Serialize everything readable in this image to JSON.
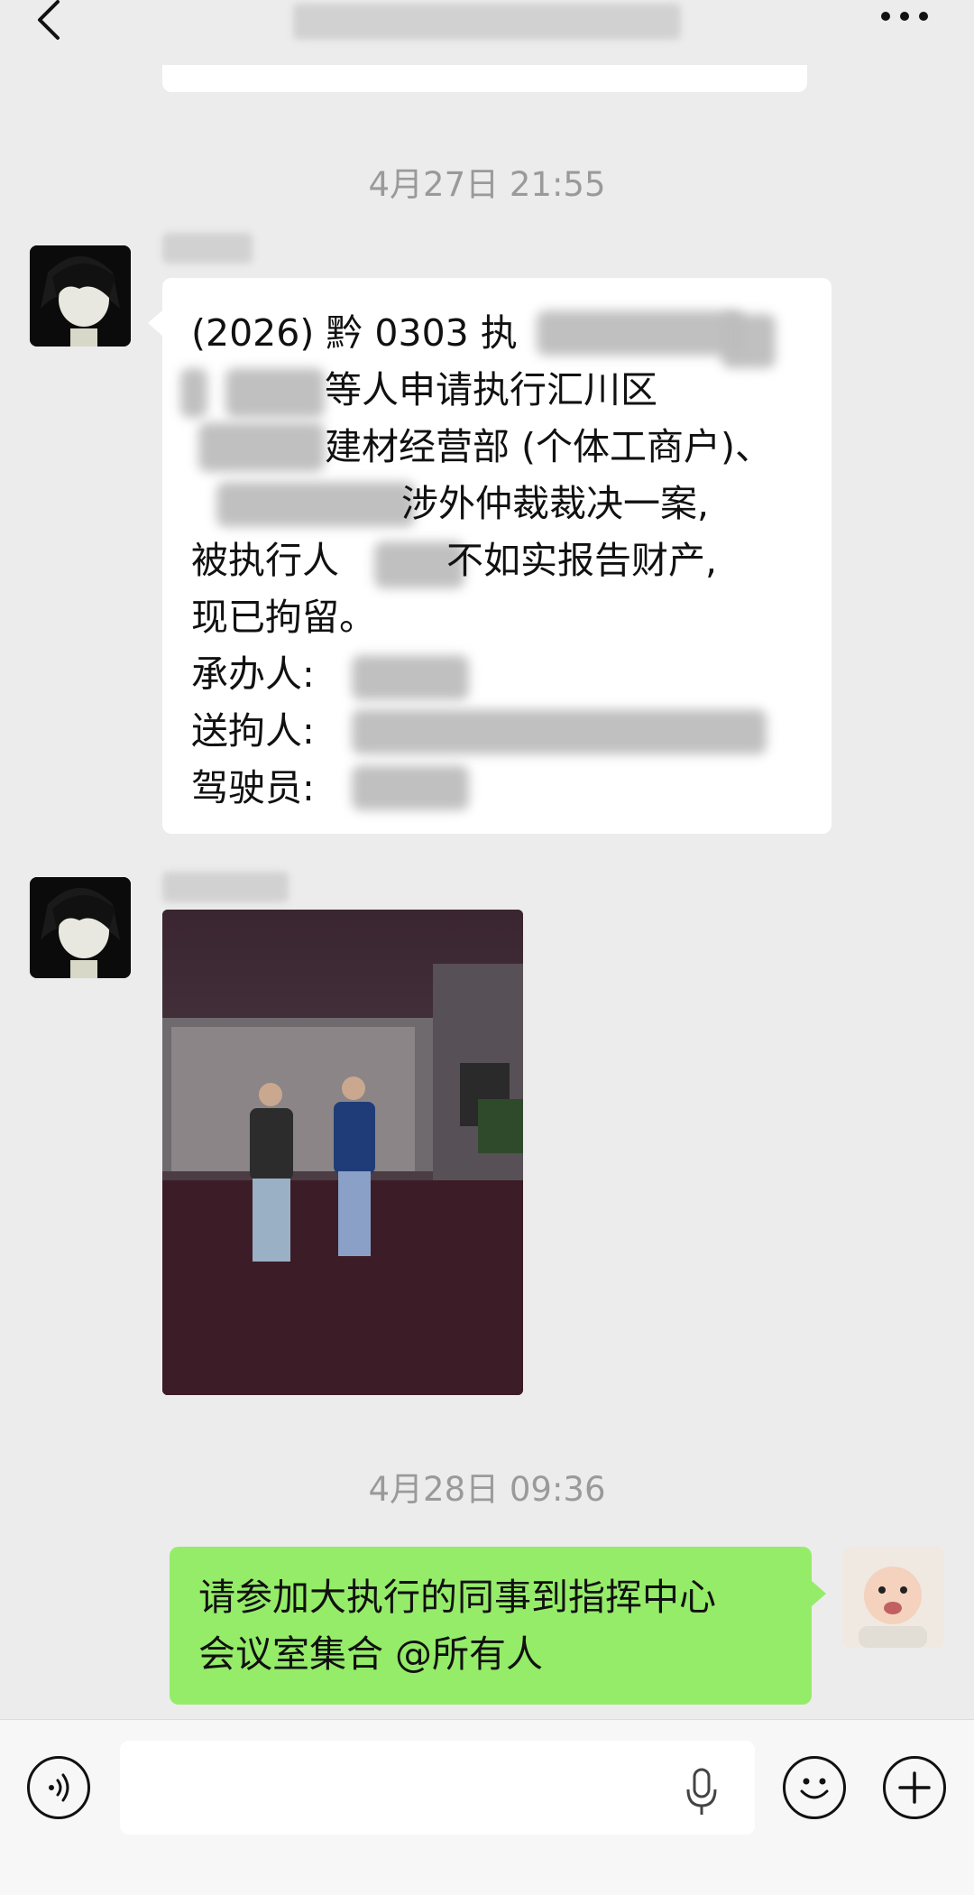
{
  "header": {
    "back_icon": "chevron-left-icon",
    "more_icon": "ellipsis-icon"
  },
  "timestamps": [
    "4月27日 21:55",
    "4月28日 09:36"
  ],
  "message1": {
    "lines": [
      "(2026) 黔 0303 执",
      "等人申请执行汇川区",
      "建材经营部 (个体工商户)、",
      "涉外仲裁裁决一案,",
      "被执行人",
      "不如实报告财产,",
      "现已拘留。",
      "承办人:",
      "送拘人:",
      "驾驶员:"
    ]
  },
  "message3": {
    "lines": [
      "请参加大执行的同事到指挥中心",
      "会议室集合 @所有人"
    ]
  },
  "inputbar": {
    "voice_icon": "voice-icon",
    "mic_icon": "microphone-icon",
    "emoji_icon": "emoji-icon",
    "plus_icon": "plus-icon"
  }
}
